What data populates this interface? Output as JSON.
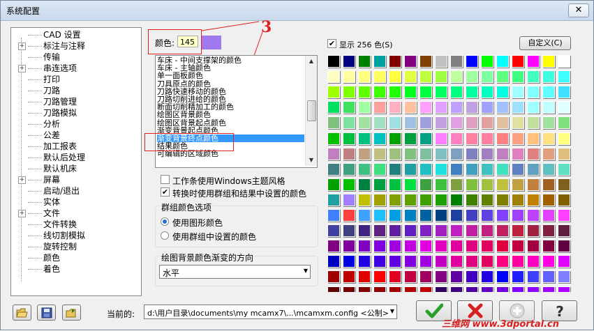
{
  "window": {
    "title": "系统配置",
    "close": "✕"
  },
  "tree": {
    "items": [
      {
        "label": "CAD 设置",
        "exp": ""
      },
      {
        "label": "标注与注释",
        "exp": "+"
      },
      {
        "label": "传输",
        "exp": ""
      },
      {
        "label": "串连选项",
        "exp": "+"
      },
      {
        "label": "打印",
        "exp": ""
      },
      {
        "label": "刀路",
        "exp": ""
      },
      {
        "label": "刀路管理",
        "exp": ""
      },
      {
        "label": "刀路模拟",
        "exp": ""
      },
      {
        "label": "分析",
        "exp": ""
      },
      {
        "label": "公差",
        "exp": ""
      },
      {
        "label": "加工报表",
        "exp": ""
      },
      {
        "label": "默认后处理",
        "exp": ""
      },
      {
        "label": "默认机床",
        "exp": ""
      },
      {
        "label": "屏幕",
        "exp": "+"
      },
      {
        "label": "启动/退出",
        "exp": ""
      },
      {
        "label": "实体",
        "exp": ""
      },
      {
        "label": "文件",
        "exp": "+"
      },
      {
        "label": "文件转换",
        "exp": ""
      },
      {
        "label": "线切割模拟",
        "exp": ""
      },
      {
        "label": "旋转控制",
        "exp": ""
      },
      {
        "label": "颜色",
        "exp": ""
      },
      {
        "label": "着色",
        "exp": ""
      }
    ]
  },
  "color": {
    "label": "颜色:",
    "value": "145",
    "swatch_color": "#a078f0"
  },
  "annotation": {
    "number": "3"
  },
  "color_list": {
    "items": [
      "车床 - 中间支撑架的颜色",
      "车床 - 主轴颜色",
      "单一面板颜色",
      "刀具原点的颜色",
      "刀路快速移动的颜色",
      "刀路切削进给的颜色",
      "断面切削精加工的颜色",
      "绘图区背景颜色",
      "绘图区背景起点颜色",
      "渐变背景起点颜色",
      "渐变背景终点颜色",
      "结果颜色",
      "可编辑的区域颜色"
    ],
    "selected_index": 10
  },
  "options": {
    "use_windows_theme": {
      "label": "工作条使用Windows主题风格",
      "checked": false
    },
    "use_group_colors": {
      "label": "转换时使用群组和结果中设置的颜色",
      "checked": true
    }
  },
  "group_color": {
    "title": "群组颜色选项",
    "opt1": "使用图形颜色",
    "opt2": "使用群组中设置的颜色",
    "selected": 1
  },
  "gradient": {
    "title": "绘图背景颜色渐变的方向",
    "value": "水平"
  },
  "show256": {
    "label": "显示 256 色(S)",
    "checked": true
  },
  "custom_button": {
    "label": "自定义(C)"
  },
  "footer": {
    "current_label": "当前的:",
    "path": "d:\\用户目录\\documents\\my mcamx7\\...\\mcamxm.config <公制>"
  },
  "watermark": "三维网 www.3dportal.cn",
  "colors": {
    "accent": "#3399ff",
    "ok_green": "#2aa02a",
    "cancel_red": "#d82020"
  },
  "palette_rows": [
    [
      "#000000",
      "#000080",
      "#008000",
      "#00a0a0",
      "#800000",
      "#800080",
      "#804000",
      "#c0c0c0",
      "#808080",
      "#0000ff",
      "#00ff00",
      "#00ffff",
      "#ff0000",
      "#ff00ff",
      "#ffff00",
      "#ffffff"
    ],
    [
      "#ffffc0",
      "#ffffa0",
      "#ffff80",
      "#ffff60",
      "#ffff40",
      "#e0ff40",
      "#c0ff40",
      "#a0ff40",
      "#c0ffa0",
      "#a0ffa0",
      "#80ffa0",
      "#60ff80",
      "#40ff80",
      "#40ffc0",
      "#40ffe0",
      "#40ffff"
    ],
    [
      "#a0ff00",
      "#80ff00",
      "#60ff00",
      "#40ff00",
      "#20ff00",
      "#00ff20",
      "#00ff40",
      "#00ff60",
      "#00ff80",
      "#00ffa0",
      "#00ffc0",
      "#00ffe0",
      "#a0ffff",
      "#80ffff",
      "#60ffff",
      "#40e0ff"
    ],
    [
      "#00e060",
      "#40e060",
      "#a0ffa0",
      "#ffa0a0",
      "#ffb0c0",
      "#ffc0a0",
      "#ffa0ff",
      "#e0a0ff",
      "#c0a0ff",
      "#c0a0e0",
      "#a0a0ff",
      "#a0c0ff",
      "#a0e0ff",
      "#a0ffff",
      "#c0ffff",
      "#e0ffff"
    ],
    [
      "#80c080",
      "#80e0a0",
      "#a0e0a0",
      "#a0e0c0",
      "#a0e0e0",
      "#a0c0e0",
      "#a0a0e0",
      "#c0a0e0",
      "#e0a0e0",
      "#e0a0c0",
      "#e0a0a0",
      "#e0c0a0",
      "#e0e0a0",
      "#c0e0a0",
      "#a0e0a0",
      "#80e080"
    ],
    [
      "#00c000",
      "#00c040",
      "#00c080",
      "#00c0c0",
      "#00a000",
      "#00a040",
      "#00a080",
      "#ff80ff",
      "#ff80c0",
      "#ff80a0",
      "#ff80a0",
      "#ff8080",
      "#ffa080",
      "#ffc080",
      "#ffe080",
      "#ffff80"
    ],
    [
      "#c080c0",
      "#c08080",
      "#c0a080",
      "#c0c080",
      "#a0c080",
      "#80c080",
      "#80c0a0",
      "#80c0c0",
      "#80a0c0",
      "#8080c0",
      "#a080c0",
      "#c080c0",
      "#e080c0",
      "#e08080",
      "#e0a080",
      "#e0c080"
    ],
    [
      "#408080",
      "#40a080",
      "#40c080",
      "#40e080",
      "#208080",
      "#20a0a0",
      "#20c0c0",
      "#20e0e0",
      "#4080c0",
      "#40a0c0",
      "#40c0c0",
      "#40e0c0",
      "#6080c0",
      "#60a0c0",
      "#60c0c0",
      "#60e0c0"
    ],
    [
      "#00a000",
      "#00c000",
      "#008040",
      "#00a040",
      "#00c040",
      "#00e040",
      "#40a040",
      "#40c040",
      "#80a040",
      "#80c040",
      "#a0c040",
      "#c0c040",
      "#c0a040",
      "#c08040",
      "#a06020",
      "#806020"
    ],
    [
      "#20a0a0",
      "#a080ff",
      "#c0c000",
      "#a0a000",
      "#80a000",
      "#60a000",
      "#40a000",
      "#20a000",
      "#008000",
      "#408000",
      "#608000",
      "#808000",
      "#a08000",
      "#c08000",
      "#a06000",
      "#806000"
    ],
    [
      "#4080ff",
      "#ff4040",
      "#40a0ff",
      "#20c0ff",
      "#00a0e0",
      "#0080c0",
      "#0060a0",
      "#004080",
      "#2040a0",
      "#4040c0",
      "#6040e0",
      "#8040ff",
      "#a040ff",
      "#c040ff",
      "#e040ff",
      "#ff40ff"
    ],
    [
      "#4040a0",
      "#404080",
      "#402080",
      "#602080",
      "#6020a0",
      "#6020c0",
      "#8020c0",
      "#a020c0",
      "#c020c0",
      "#c020a0",
      "#c02080",
      "#c02060",
      "#c02040",
      "#a02040",
      "#802040",
      "#602040"
    ],
    [
      "#800080",
      "#8000a0",
      "#8000c0",
      "#8000e0",
      "#a000e0",
      "#c000e0",
      "#e000e0",
      "#e000c0",
      "#e000a0",
      "#e00080",
      "#e00060",
      "#e00040",
      "#c00040",
      "#a00040",
      "#800040",
      "#600040"
    ],
    [
      "#0000c0",
      "#0000e0",
      "#2000e0",
      "#4000e0",
      "#6000e0",
      "#8000e0",
      "#a000e0",
      "#c000c0",
      "#e000a0",
      "#e00080",
      "#e00060",
      "#ff0080",
      "#ff00a0",
      "#ff00c0",
      "#ff00e0",
      "#e000ff"
    ],
    [
      "#a00000",
      "#c00000",
      "#e00000",
      "#ff0000",
      "#e00020",
      "#c00040",
      "#a00060",
      "#800080",
      "#6000a0",
      "#4000c0",
      "#2000e0",
      "#0000ff",
      "#2020ff",
      "#4040ff",
      "#6060ff",
      "#8080ff"
    ],
    [
      "#600000",
      "#700000",
      "#800000",
      "#900000",
      "#a00000",
      "#b00000",
      "#c00000",
      "#300060",
      "#400080",
      "#5000a0",
      "#6000c0",
      "#7000e0",
      "#8000ff",
      "#9000ff",
      "#a000ff",
      "#b000ff"
    ]
  ]
}
